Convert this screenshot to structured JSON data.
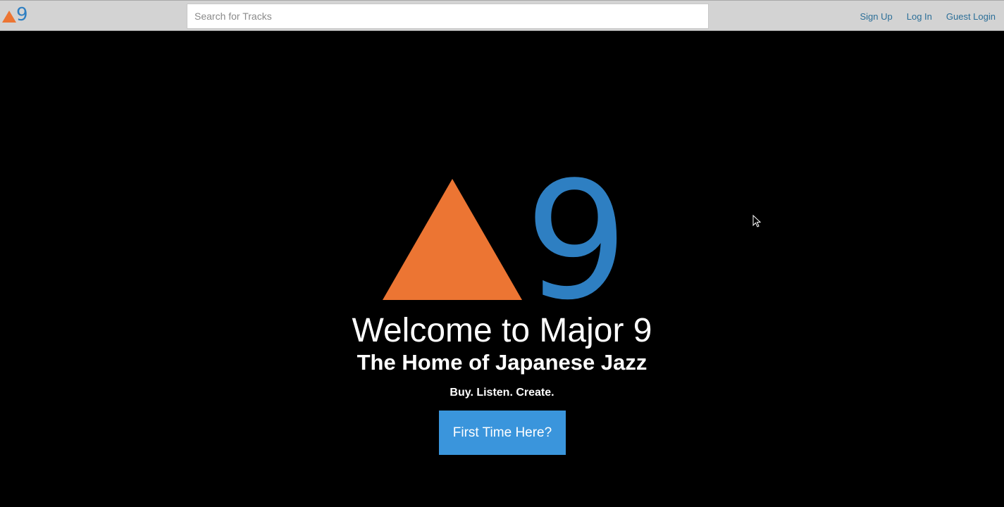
{
  "navbar": {
    "logo_text": "9",
    "search": {
      "placeholder": "Search for Tracks",
      "value": ""
    },
    "links": [
      {
        "label": "Sign Up"
      },
      {
        "label": "Log In"
      },
      {
        "label": "Guest Login"
      }
    ]
  },
  "hero": {
    "logo_text": "9",
    "title": "Welcome to Major 9",
    "subtitle": "The Home of Japanese Jazz",
    "tagline": "Buy. Listen. Create.",
    "cta_label": "First Time Here?"
  },
  "colors": {
    "navbar_bg": "#d3d3d3",
    "brand_orange": "#ec7533",
    "brand_blue": "#2e7fc2",
    "link_blue": "#2c6f98",
    "cta_blue": "#3a95dc",
    "hero_bg": "#000000"
  },
  "icons": {
    "nav_logo": "triangle-nine-logo",
    "hero_logo": "triangle-nine-logo",
    "cursor": "mouse-pointer-icon"
  }
}
